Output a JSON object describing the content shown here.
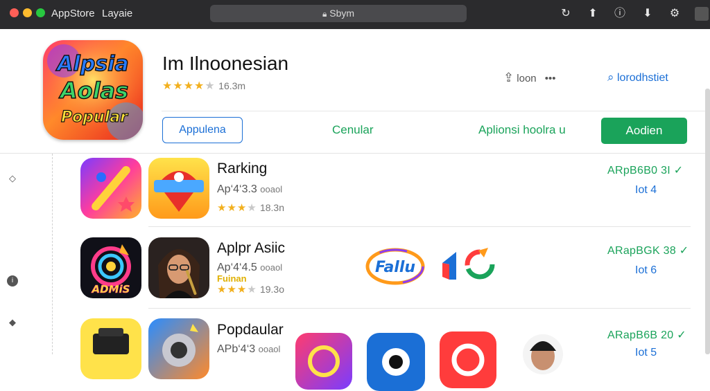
{
  "window": {
    "app_name": "AppStore",
    "menu_label": "Layaie",
    "address": "Sbym",
    "traffic_lights": [
      "#ff5f57",
      "#febc2e",
      "#28c840"
    ],
    "toolbar_icons": [
      "refresh-icon",
      "share-icon",
      "info-icon",
      "download-icon",
      "settings-icon",
      "window-icon"
    ]
  },
  "app": {
    "icon_text": [
      "Alpsia",
      "Aolas",
      "Popular"
    ],
    "title": "Im Ilnoonesian",
    "stars_on": "★★★★",
    "stars_off": "★",
    "rating_count": "16.3m",
    "share_label": "loon",
    "more_label": "•••",
    "report_link": "lorodhstiet"
  },
  "actions": {
    "outline_button": "Appulena",
    "tab_center": "Cenular",
    "tab_right": "Aplionsi hoolra u",
    "primary_button": "Aodien"
  },
  "rows": [
    {
      "title": "Rarking",
      "subtitle": "Ap‘4‘3.3",
      "subtitle_tail": "ooaol",
      "stars_on": "★★★",
      "stars_off": "★",
      "count": "18.3n",
      "right_top": "ARpB6B0 3I ✓",
      "right_bottom": "Iot 4"
    },
    {
      "title": "Aplpr Asiic",
      "subtitle": "Ap‘4‘4.5",
      "subtitle_tail": "ooaol",
      "tagline": "Fuinan",
      "stars_on": "★★★",
      "stars_off": "★",
      "count": "19.3o",
      "right_top": "ARapBGK 38 ✓",
      "right_bottom": "Iot 6",
      "brands": [
        "Fallu"
      ]
    },
    {
      "title": "Popdaular",
      "subtitle": "APb‘4‘3",
      "subtitle_tail": "ooaol",
      "right_top": "ARapB6B 20 ✓",
      "right_bottom": "Iot 5"
    }
  ],
  "colors": {
    "accent_blue": "#1b6fd6",
    "accent_green": "#1aa35a",
    "star": "#f2b01e",
    "titlebar": "#2b2b2d"
  }
}
